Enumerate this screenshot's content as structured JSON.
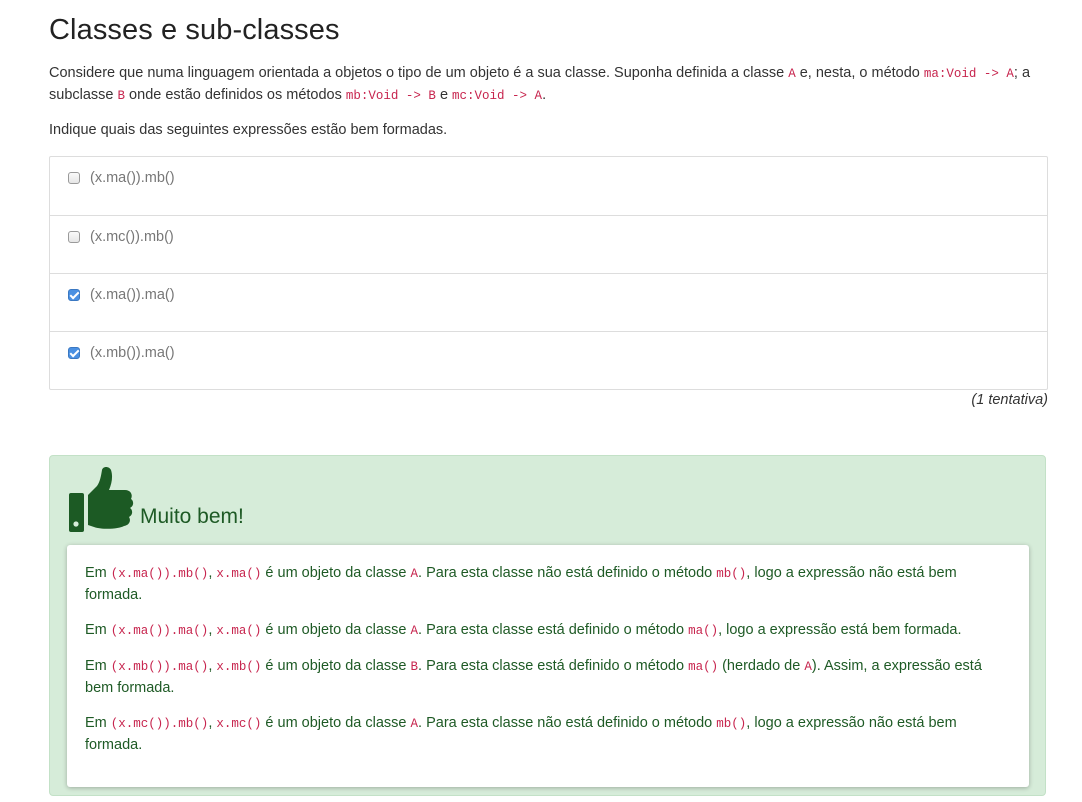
{
  "title": "Classes e sub-classes",
  "intro": [
    {
      "t": "Considere que numa linguagem orientada a objetos o tipo de um objeto é a sua classe. Suponha definida a classe "
    },
    {
      "c": "A"
    },
    {
      "t": " e, nesta, o método "
    },
    {
      "c": "ma:Void -> A"
    },
    {
      "t": "; a subclasse "
    },
    {
      "c": "B"
    },
    {
      "t": " onde estão definidos os métodos "
    },
    {
      "c": "mb:Void -> B"
    },
    {
      "t": " e "
    },
    {
      "c": "mc:Void -> A"
    },
    {
      "t": "."
    }
  ],
  "ask": "Indique quais das seguintes expressões estão bem formadas.",
  "options": [
    {
      "label": "(x.ma()).mb()",
      "checked": false
    },
    {
      "label": "(x.mc()).mb()",
      "checked": false
    },
    {
      "label": "(x.ma()).ma()",
      "checked": true
    },
    {
      "label": "(x.mb()).ma()",
      "checked": true
    }
  ],
  "attempts": "(1 tentativa)",
  "feedback": {
    "icon": "thumbs-up-icon",
    "title": "Muito bem!",
    "paragraphs": [
      [
        {
          "t": "Em "
        },
        {
          "c": "(x.ma()).mb()"
        },
        {
          "t": ", "
        },
        {
          "c": "x.ma()"
        },
        {
          "t": " é um objeto da classe "
        },
        {
          "c": "A"
        },
        {
          "t": ". Para esta classe não está definido o método "
        },
        {
          "c": "mb()"
        },
        {
          "t": ", logo a expressão não está bem formada."
        }
      ],
      [
        {
          "t": "Em "
        },
        {
          "c": "(x.ma()).ma()"
        },
        {
          "t": ", "
        },
        {
          "c": "x.ma()"
        },
        {
          "t": " é um objeto da classe "
        },
        {
          "c": "A"
        },
        {
          "t": ". Para esta classe está definido o método "
        },
        {
          "c": "ma()"
        },
        {
          "t": ", logo a expressão está bem formada."
        }
      ],
      [
        {
          "t": "Em "
        },
        {
          "c": "(x.mb()).ma()"
        },
        {
          "t": ", "
        },
        {
          "c": "x.mb()"
        },
        {
          "t": " é um objeto da classe "
        },
        {
          "c": "B"
        },
        {
          "t": ". Para esta classe está definido o método "
        },
        {
          "c": "ma()"
        },
        {
          "t": " (herdado de "
        },
        {
          "c": "A"
        },
        {
          "t": "). Assim, a expressão está bem formada."
        }
      ],
      [
        {
          "t": "Em "
        },
        {
          "c": "(x.mc()).mb()"
        },
        {
          "t": ", "
        },
        {
          "c": "x.mc()"
        },
        {
          "t": " é um objeto da classe "
        },
        {
          "c": "A"
        },
        {
          "t": ". Para esta classe não está definido o método "
        },
        {
          "c": "mb()"
        },
        {
          "t": ", logo a expressão não está bem formada."
        }
      ]
    ]
  },
  "colors": {
    "code": "#c7254e",
    "success_bg": "#d6ecd9",
    "success_text": "#1e5a25",
    "checkbox_checked": "#4a90e2"
  }
}
